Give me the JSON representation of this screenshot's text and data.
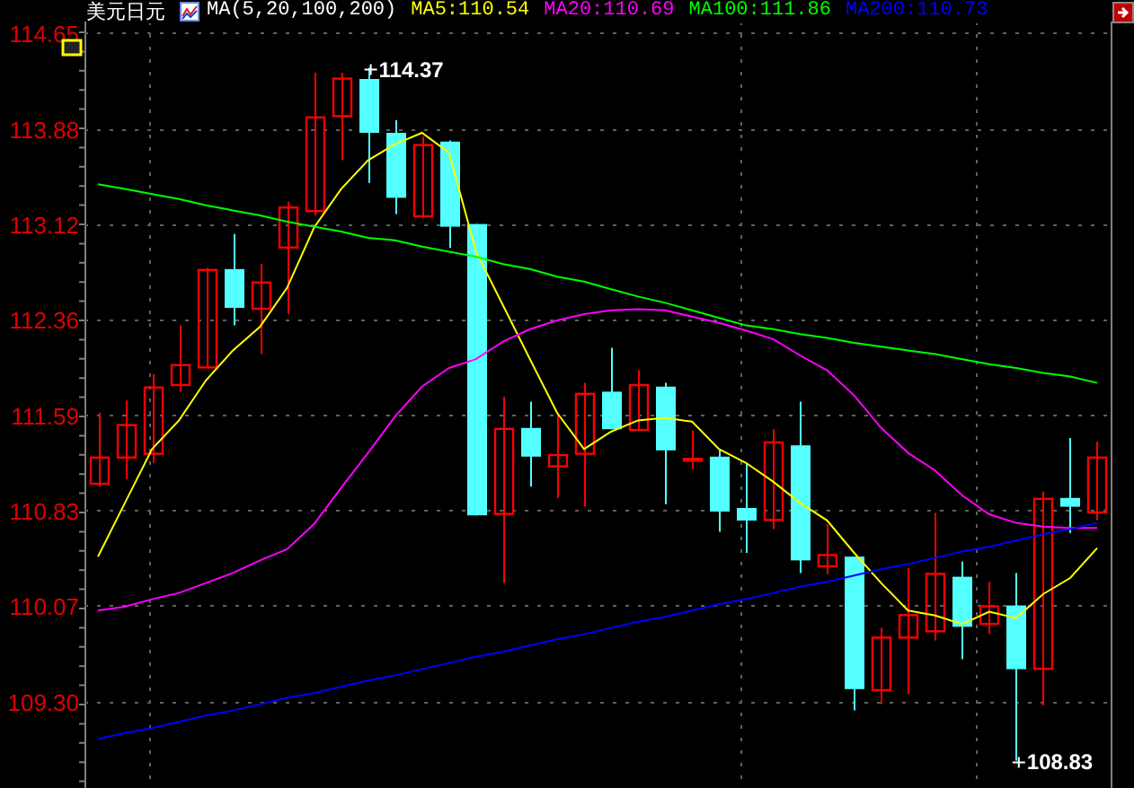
{
  "header": {
    "symbol": "美元日元",
    "indicator": "MA(5,20,100,200)",
    "readings": [
      {
        "label": "MA5:110.54",
        "color": "#ffff00"
      },
      {
        "label": "MA20:110.69",
        "color": "#ff00ff"
      },
      {
        "label": "MA100:111.86",
        "color": "#00ff00"
      },
      {
        "label": "MA200:110.73",
        "color": "#0000ff"
      }
    ]
  },
  "chart_data": {
    "type": "candlestick",
    "grid": true,
    "categories": [
      null,
      null,
      null,
      null,
      null,
      null,
      null,
      null,
      null,
      null,
      null,
      null,
      null,
      null,
      null,
      null,
      null,
      null,
      null,
      null,
      null,
      null,
      null,
      null,
      null,
      null,
      null,
      null,
      null,
      null,
      null,
      null,
      null,
      null,
      null,
      null,
      null,
      null
    ],
    "ylim": [
      108.61,
      114.74
    ],
    "yticks": [
      {
        "value": 114.65,
        "label": "114.65"
      },
      {
        "value": 113.88,
        "label": "113.88"
      },
      {
        "value": 113.12,
        "label": "113.12"
      },
      {
        "value": 112.36,
        "label": "112.36"
      },
      {
        "value": 111.59,
        "label": "111.59"
      },
      {
        "value": 110.83,
        "label": "110.83"
      },
      {
        "value": 110.07,
        "label": "110.07"
      },
      {
        "value": 109.3,
        "label": "109.30"
      }
    ],
    "ohlc": [
      [
        111.05,
        111.61,
        111.02,
        111.26
      ],
      [
        111.26,
        111.71,
        111.08,
        111.52
      ],
      [
        111.29,
        111.92,
        111.21,
        111.82
      ],
      [
        111.84,
        112.31,
        111.78,
        112.0
      ],
      [
        111.98,
        112.77,
        111.98,
        112.76
      ],
      [
        112.76,
        113.04,
        112.31,
        112.45
      ],
      [
        112.45,
        112.8,
        112.08,
        112.66
      ],
      [
        112.94,
        113.3,
        112.4,
        113.26
      ],
      [
        113.23,
        114.33,
        113.19,
        113.98
      ],
      [
        113.99,
        114.33,
        113.63,
        114.29
      ],
      [
        114.28,
        114.37,
        113.45,
        113.85
      ],
      [
        113.85,
        113.95,
        113.2,
        113.33
      ],
      [
        113.19,
        113.82,
        113.17,
        113.76
      ],
      [
        113.78,
        113.79,
        112.93,
        113.1
      ],
      [
        113.12,
        113.12,
        110.79,
        110.79
      ],
      [
        110.81,
        111.74,
        110.25,
        111.49
      ],
      [
        111.49,
        111.7,
        111.02,
        111.26
      ],
      [
        111.19,
        111.61,
        110.93,
        111.28
      ],
      [
        111.29,
        111.85,
        110.86,
        111.77
      ],
      [
        111.78,
        112.13,
        111.48,
        111.48
      ],
      [
        111.48,
        111.95,
        111.48,
        111.84
      ],
      [
        111.82,
        111.85,
        110.88,
        111.31
      ],
      [
        111.24,
        111.47,
        111.16,
        111.25
      ],
      [
        111.26,
        111.31,
        110.66,
        110.82
      ],
      [
        110.85,
        111.21,
        110.49,
        110.75
      ],
      [
        110.76,
        111.48,
        110.68,
        111.38
      ],
      [
        111.35,
        111.7,
        110.33,
        110.43
      ],
      [
        110.39,
        110.72,
        110.32,
        110.48
      ],
      [
        110.46,
        110.46,
        109.23,
        109.4
      ],
      [
        109.4,
        109.89,
        109.28,
        109.82
      ],
      [
        109.82,
        110.37,
        109.36,
        110.0
      ],
      [
        109.87,
        110.81,
        109.79,
        110.33
      ],
      [
        110.3,
        110.42,
        109.64,
        109.9
      ],
      [
        109.93,
        110.26,
        109.84,
        110.07
      ],
      [
        110.07,
        110.33,
        108.83,
        109.56
      ],
      [
        109.57,
        110.98,
        109.27,
        110.93
      ],
      [
        110.93,
        111.41,
        110.65,
        110.86
      ],
      [
        110.82,
        111.38,
        110.75,
        111.26
      ]
    ],
    "series": [
      {
        "type": "line",
        "color": "#ffff00",
        "values": [
          110.46,
          110.89,
          111.32,
          111.55,
          111.87,
          112.11,
          112.3,
          112.61,
          113.09,
          113.4,
          113.63,
          113.76,
          113.85,
          113.69,
          112.9,
          112.47,
          112.04,
          111.61,
          111.32,
          111.46,
          111.55,
          111.57,
          111.54,
          111.32,
          111.21,
          111.06,
          110.89,
          110.75,
          110.49,
          110.25,
          110.03,
          109.99,
          109.92,
          110.02,
          109.97,
          110.16,
          110.29,
          110.53
        ]
      },
      {
        "type": "line",
        "color": "#ff00ff",
        "values": [
          110.03,
          110.06,
          110.12,
          110.17,
          110.25,
          110.33,
          110.43,
          110.52,
          110.72,
          111.01,
          111.29,
          111.58,
          111.82,
          111.97,
          112.04,
          112.18,
          112.28,
          112.35,
          112.4,
          112.43,
          112.44,
          112.43,
          112.38,
          112.33,
          112.27,
          112.2,
          112.07,
          111.95,
          111.75,
          111.49,
          111.29,
          111.15,
          110.95,
          110.8,
          110.73,
          110.7,
          110.69,
          110.69
        ]
      },
      {
        "type": "line",
        "color": "#00ff00",
        "values": [
          113.44,
          113.4,
          113.36,
          113.32,
          113.27,
          113.23,
          113.19,
          113.14,
          113.1,
          113.06,
          113.01,
          112.99,
          112.94,
          112.9,
          112.86,
          112.8,
          112.76,
          112.7,
          112.66,
          112.6,
          112.54,
          112.49,
          112.43,
          112.37,
          112.31,
          112.28,
          112.24,
          112.21,
          112.17,
          112.14,
          112.11,
          112.08,
          112.04,
          112.0,
          111.97,
          111.93,
          111.9,
          111.85
        ]
      },
      {
        "type": "line",
        "color": "#0000ff",
        "values": [
          109.0,
          109.05,
          109.09,
          109.14,
          109.19,
          109.23,
          109.28,
          109.33,
          109.37,
          109.42,
          109.47,
          109.51,
          109.56,
          109.61,
          109.66,
          109.7,
          109.75,
          109.8,
          109.84,
          109.89,
          109.94,
          109.98,
          110.03,
          110.08,
          110.12,
          110.17,
          110.22,
          110.26,
          110.31,
          110.36,
          110.4,
          110.45,
          110.5,
          110.54,
          110.59,
          110.64,
          110.68,
          110.73
        ]
      }
    ],
    "annotations": [
      {
        "text": "114.37"
      },
      {
        "text": "108.83"
      }
    ]
  }
}
